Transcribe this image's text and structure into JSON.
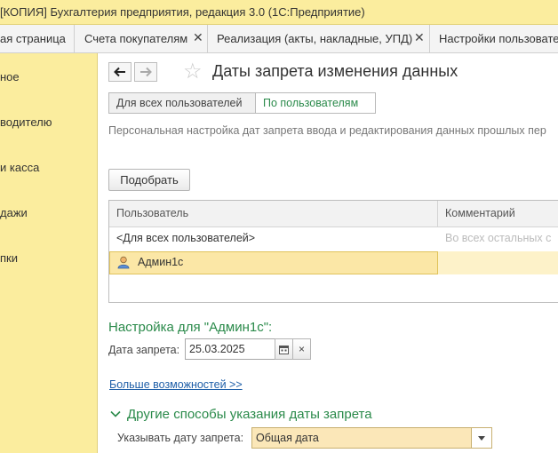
{
  "window": {
    "title": "[КОПИЯ] Бухгалтерия предприятия, редакция 3.0  (1С:Предприятие)"
  },
  "tabs": [
    {
      "label": "ая страница",
      "closable": false
    },
    {
      "label": "Счета покупателям",
      "closable": true
    },
    {
      "label": "Реализация (акты, накладные, УПД)",
      "closable": true
    },
    {
      "label": "Настройки пользовате",
      "closable": false
    }
  ],
  "sidebar": {
    "items": [
      {
        "label": "ное"
      },
      {
        "label": "водителю"
      },
      {
        "label": "и касса"
      },
      {
        "label": "дажи"
      },
      {
        "label": "пки"
      }
    ]
  },
  "form": {
    "title": "Даты запрета изменения данных",
    "modes": [
      {
        "label": "Для всех пользователей",
        "active": false
      },
      {
        "label": "По пользователям",
        "active": true
      }
    ],
    "description": "Персональная настройка дат запрета ввода и редактирования данных прошлых пер",
    "pick_button": "Подобрать",
    "table": {
      "columns": [
        "Пользователь",
        "Комментарий"
      ],
      "rows": [
        {
          "user": "<Для всех пользователей>",
          "comment": "Во всех остальных с"
        },
        {
          "user": "Админ1с",
          "comment": "",
          "selected": true
        }
      ]
    },
    "settings_title": "Настройка для \"Админ1с\":",
    "date_label": "Дата запрета:",
    "date_value": "25.03.2025",
    "clear_symbol": "×",
    "more_link": "Больше возможностей >>",
    "other_title": "Другие способы указания даты запрета",
    "specify_label": "Указывать дату запрета:",
    "specify_value": "Общая дата"
  },
  "colors": {
    "accent_yellow": "#fbed9e",
    "section_green": "#2a8a4a",
    "link_blue": "#1f5fa8",
    "selected_row": "#fbe7a6"
  }
}
